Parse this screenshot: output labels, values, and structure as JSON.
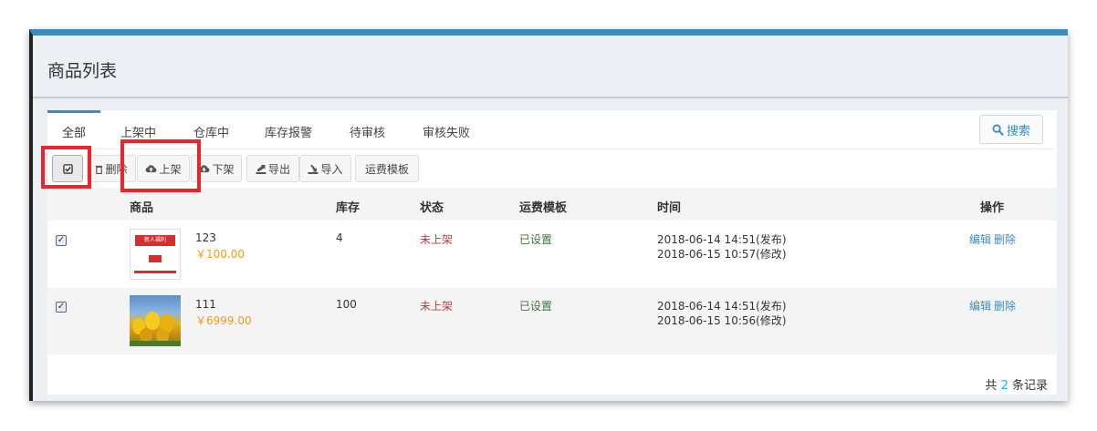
{
  "page": {
    "title": "商品列表"
  },
  "tabs": [
    "全部",
    "上架中",
    "仓库中",
    "库存报警",
    "待审核",
    "审核失败"
  ],
  "search": {
    "label": "搜索",
    "icon": "search-icon"
  },
  "toolbar": {
    "delete_label": "删除",
    "onshelf_label": "上架",
    "offshelf_label": "下架",
    "export_label": "导出",
    "import_label": "导入",
    "freight_label": "运费模板"
  },
  "table": {
    "headers": {
      "product": "商品",
      "stock": "库存",
      "status": "状态",
      "freight": "运费模板",
      "time": "时间",
      "action": "操作"
    },
    "rows": [
      {
        "checked": true,
        "name": "123",
        "price": "￥100.00",
        "stock": "4",
        "status": "未上架",
        "freight": "已设置",
        "time_published": "2018-06-14 14:51(发布)",
        "time_modified": "2018-06-15 10:57(修改)",
        "edit": "编辑",
        "delete": "删除",
        "thumb_text": "新人福利"
      },
      {
        "checked": true,
        "name": "111",
        "price": "￥6999.00",
        "stock": "100",
        "status": "未上架",
        "freight": "已设置",
        "time_published": "2018-06-14 14:51(发布)",
        "time_modified": "2018-06-15 10:56(修改)",
        "edit": "编辑",
        "delete": "删除"
      }
    ]
  },
  "footer": {
    "prefix": "共",
    "count": "2",
    "suffix": "条记录"
  },
  "colors": {
    "accent": "#3c8dbc",
    "highlight": "#e8262b",
    "price": "#f39c12",
    "status_off": "#a94442",
    "status_set": "#3c763d"
  }
}
